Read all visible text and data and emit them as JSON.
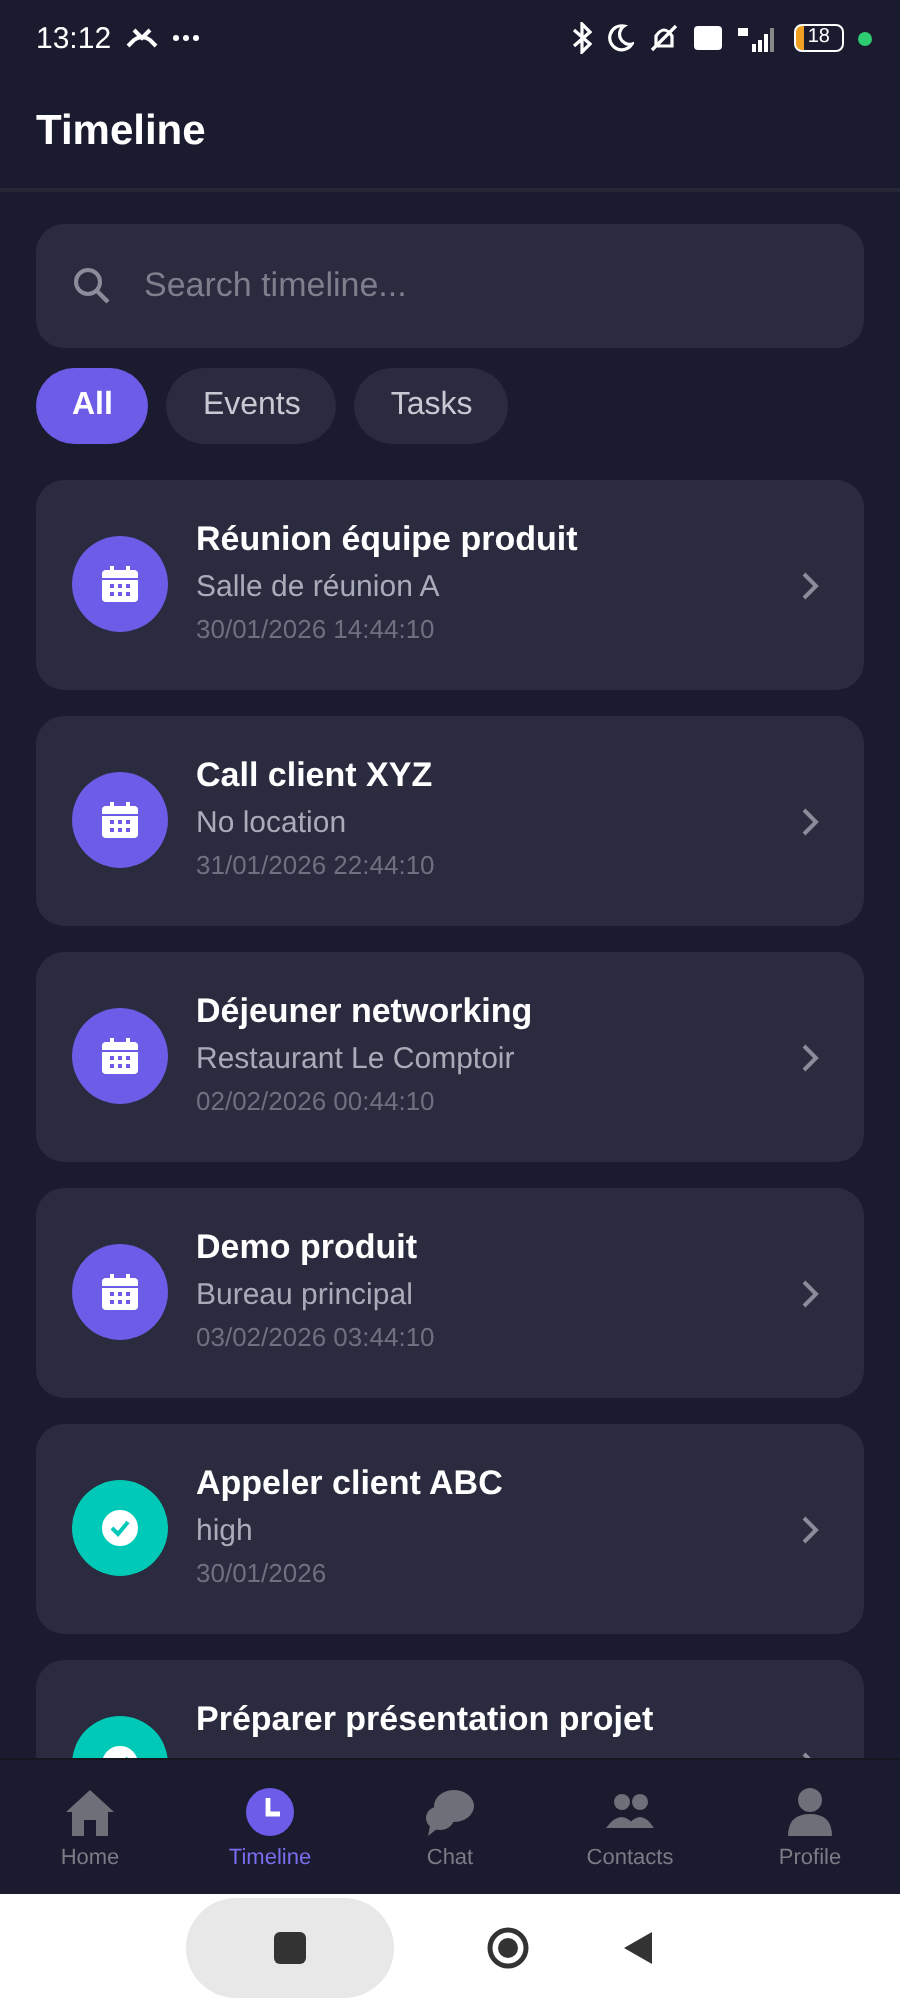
{
  "status_bar": {
    "time": "13:12",
    "battery": "18"
  },
  "header": {
    "title": "Timeline"
  },
  "search": {
    "placeholder": "Search timeline..."
  },
  "filters": [
    {
      "label": "All",
      "selected": true
    },
    {
      "label": "Events",
      "selected": false
    },
    {
      "label": "Tasks",
      "selected": false
    }
  ],
  "items": [
    {
      "kind": "event",
      "title": "Réunion équipe produit",
      "subtitle": "Salle de réunion A",
      "date": "30/01/2026 14:44:10"
    },
    {
      "kind": "event",
      "title": "Call client XYZ",
      "subtitle": "No location",
      "date": "31/01/2026 22:44:10"
    },
    {
      "kind": "event",
      "title": "Déjeuner networking",
      "subtitle": "Restaurant Le Comptoir",
      "date": "02/02/2026 00:44:10"
    },
    {
      "kind": "event",
      "title": "Demo produit",
      "subtitle": "Bureau principal",
      "date": "03/02/2026 03:44:10"
    },
    {
      "kind": "task",
      "title": "Appeler client ABC",
      "subtitle": "high",
      "date": "30/01/2026"
    },
    {
      "kind": "task",
      "title": "Préparer présentation projet"
    }
  ],
  "bottom_nav": [
    {
      "label": "Home",
      "selected": false
    },
    {
      "label": "Timeline",
      "selected": true
    },
    {
      "label": "Chat",
      "selected": false
    },
    {
      "label": "Contacts",
      "selected": false
    },
    {
      "label": "Profile",
      "selected": false
    }
  ]
}
